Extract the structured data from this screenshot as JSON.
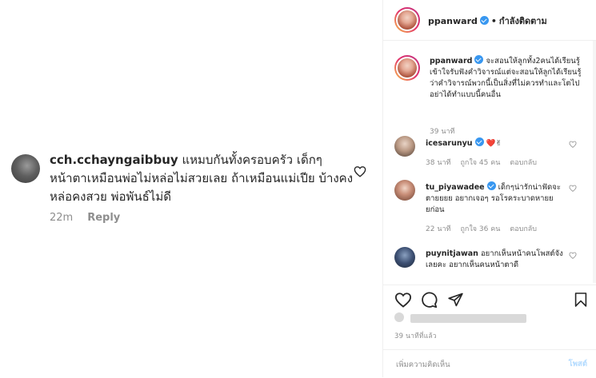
{
  "left_comment": {
    "username": "cch.cchayngaibbuy",
    "text": " แหมบกันทั้งครอบครัว เด็กๆ หน้าตาเหมือนพ่อไม่หล่อไม่สวยเลย ถ้าเหมือนแม่เปีย บ้างคงหล่อคงสวย พ่อพันธ์ไม่ดี",
    "time": "22m",
    "reply_label": "Reply"
  },
  "header": {
    "username": "ppanward",
    "separator": "•",
    "follow_label": "กำลังติดตาม"
  },
  "caption": {
    "username": "ppanward",
    "text": " จะสอนให้ลูกทั้ง2คนได้เรียนรู้เข้าใจรับฟังคำวิจารณ์แต่จะสอนให้ลูกได้เรียนรู้ว่าคำวิจารณ์พวกนี้เป็นสิ่งที่ไม่ควรทำและโตไปอย่าได้ทำแบบนี้คนอื่น",
    "time": "39 นาที"
  },
  "comments": [
    {
      "username": "icesarunyu",
      "text": " ❤️✌",
      "time": "38 นาที",
      "likes": "ถูกใจ 45 คน",
      "reply": "ตอบกลับ"
    },
    {
      "username": "tu_piyawadee",
      "text": " เด็กๆน่ารักน่าฟัดจะตายยยย อยากเจอๆ รอโรคระบาดหายยยก่อน",
      "time": "22 นาที",
      "likes": "ถูกใจ 36 คน",
      "reply": "ตอบกลับ"
    },
    {
      "username": "puynitjawan",
      "text": " อยากเห็นหน้าคนโพสต์จังเลยคะ อยากเห็นคนหน้าตาดี",
      "time": "",
      "likes": "",
      "reply": ""
    }
  ],
  "post_time": "39 นาทีที่แล้ว",
  "add_comment": {
    "placeholder": "เพิ่มความคิดเห็น",
    "post_label": "โพสต์"
  },
  "colors": {
    "verified": "#3897f0",
    "post_disabled": "#b3dbff",
    "muted": "#8e8e8e"
  }
}
